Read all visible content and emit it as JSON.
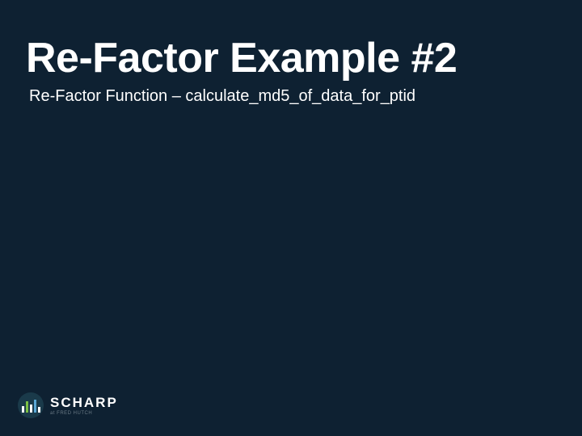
{
  "slide": {
    "title": "Re-Factor Example #2",
    "subtitle": "Re-Factor Function – calculate_md5_of_data_for_ptid"
  },
  "footer": {
    "logo_text": "SCHARP",
    "logo_subtext": "at FRED HUTCH"
  }
}
